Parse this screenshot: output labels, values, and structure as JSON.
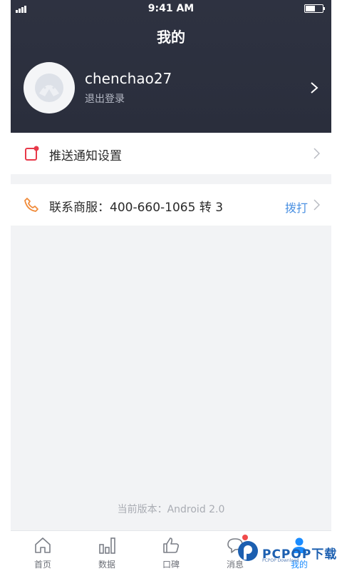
{
  "status_bar": {
    "time": "9:41 AM"
  },
  "header": {
    "title": "我的"
  },
  "profile": {
    "username": "chenchao27",
    "logout_label": "退出登录"
  },
  "rows": {
    "push": {
      "label": "推送通知设置",
      "icon": "notification-icon"
    },
    "service": {
      "label": "联系商服：400-660-1065 转 3",
      "action_label": "拨打",
      "icon": "phone-icon"
    }
  },
  "version_text": "当前版本：Android 2.0",
  "tabbar": {
    "tabs": [
      {
        "label": "首页",
        "icon": "home-icon"
      },
      {
        "label": "数据",
        "icon": "bar-chart-icon"
      },
      {
        "label": "口碑",
        "icon": "thumbs-up-icon"
      },
      {
        "label": "消息",
        "icon": "message-icon"
      },
      {
        "label": "我的",
        "icon": "user-icon"
      }
    ],
    "active_index": 4
  },
  "watermark": {
    "text": "PCPOP下载",
    "subtext": "PCPOP Download"
  },
  "colors": {
    "header_bg": "#2e3241",
    "accent": "#1a8cff",
    "link": "#4a90e2",
    "notification_red": "#e8394a",
    "phone_orange": "#f08b3a",
    "badge_red": "#f04b4b"
  }
}
